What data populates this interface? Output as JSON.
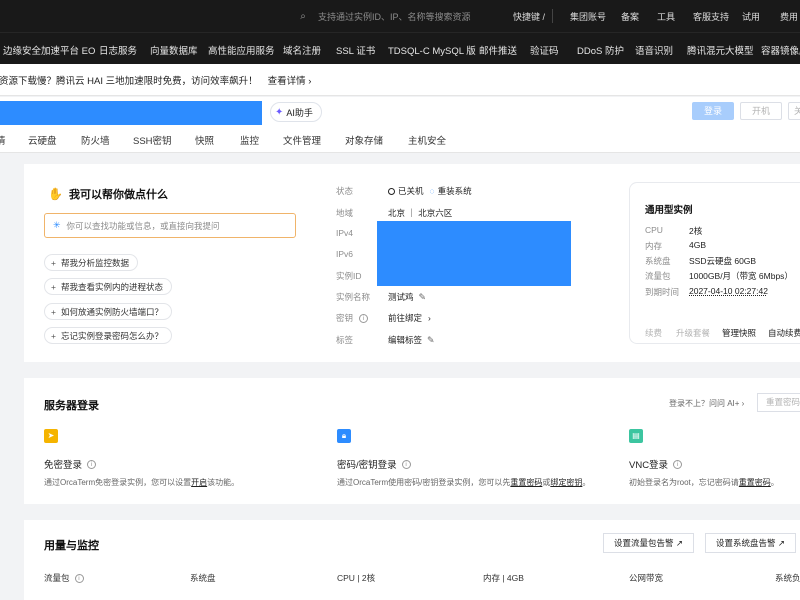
{
  "topbar": {
    "search_placeholder": "支持通过实例ID、IP、名称等搜索资源",
    "shortcut": "快捷键 /",
    "nav": [
      "集团账号",
      "备案",
      "工具",
      "客服支持",
      "试用",
      "费用"
    ]
  },
  "products": [
    "边缘安全加速平台 EO",
    "日志服务",
    "向量数据库",
    "高性能应用服务",
    "域名注册",
    "SSL 证书",
    "TDSQL-C MySQL 版",
    "邮件推送",
    "验证码",
    "DDoS 防护",
    "语音识别",
    "腾讯混元大模型",
    "容器镜像服务"
  ],
  "notice": {
    "text": "资源下载慢？腾讯云 HAI 三地加速限时免费，访问效率飙升！",
    "link": "查看详情 ›"
  },
  "header": {
    "ai_button": "AI助手",
    "login_button": "登录",
    "start_button": "开机",
    "shutdown_button": "关机"
  },
  "tabs": [
    "云硬盘",
    "防火墙",
    "SSH密钥",
    "快照",
    "监控",
    "文件管理",
    "对象存储",
    "主机安全"
  ],
  "ai_helper": {
    "title": "我可以帮你做点什么",
    "input_placeholder": "你可以查找功能或信息，或直接向我提问",
    "chips": [
      "帮我分析监控数据",
      "帮我查看实例内的进程状态",
      "如何放通实例防火墙端口？",
      "忘记实例登录密码怎么办？"
    ]
  },
  "instance": {
    "labels": [
      "状态",
      "地域",
      "IPv4",
      "IPv6",
      "实例ID",
      "实例名称",
      "密钥",
      "标签"
    ],
    "status_off": "已关机",
    "status_reinstall": "重装系统",
    "region": "北京 ｜ 北京六区",
    "name": "测试鸡",
    "key_action": "前往绑定",
    "tag_action": "编辑标签"
  },
  "spec": {
    "title": "通用型实例",
    "rows": [
      {
        "k": "CPU",
        "v": "2核"
      },
      {
        "k": "内存",
        "v": "4GB"
      },
      {
        "k": "系统盘",
        "v": "SSD云硬盘 60GB"
      },
      {
        "k": "流量包",
        "v": "1000GB/月（带宽 6Mbps）"
      },
      {
        "k": "到期时间",
        "v": "2027-04-10 02:27:42"
      }
    ],
    "actions": [
      "续费",
      "升级套餐",
      "管理快照",
      "自动续费"
    ]
  },
  "login": {
    "title": "服务器登录",
    "hint": "登录不上？问问 AI+ ›",
    "reset_button": "重置密码",
    "methods": [
      {
        "name": "免密登录",
        "desc_a": "通过OrcaTerm免密登录实例，您可以设置",
        "desc_link": "开启",
        "desc_b": "该功能。"
      },
      {
        "name": "密码/密钥登录",
        "desc_a": "通过OrcaTerm使用密码/密钥登录实例，您可以先",
        "desc_link": "重置密码",
        "desc_b": "或",
        "desc_link2": "绑定密钥",
        "desc_c": "。"
      },
      {
        "name": "VNC登录",
        "desc_a": "初始登录名为root，忘记密码请",
        "desc_link": "重置密码",
        "desc_b": "。"
      }
    ]
  },
  "usage": {
    "title": "用量与监控",
    "btn_traffic": "设置流量包告警 ↗",
    "btn_disk": "设置系统盘告警 ↗",
    "metrics": [
      "流量包",
      "系统盘",
      "CPU | 2核",
      "内存 | 4GB",
      "公网带宽",
      "系统负"
    ]
  },
  "colors": {
    "accent": "#2d8cff",
    "dark_bar": "#191919"
  }
}
